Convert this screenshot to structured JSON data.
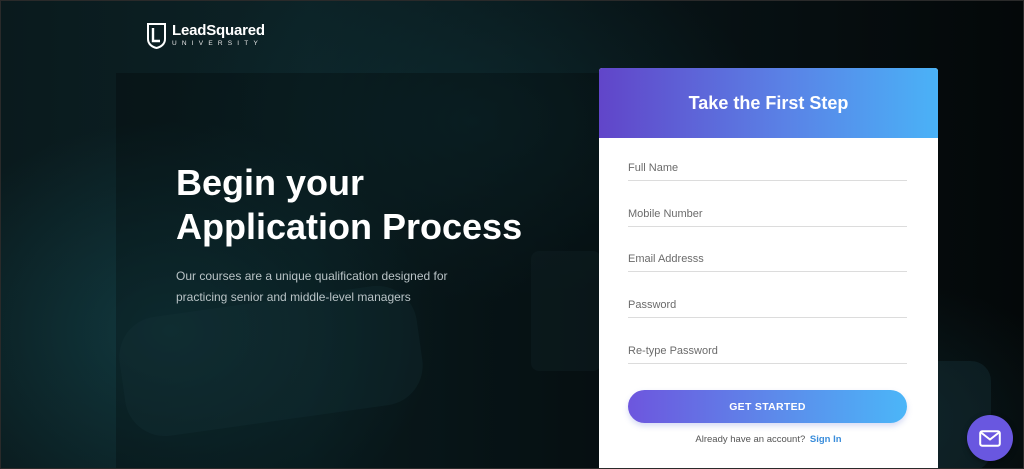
{
  "brand": {
    "name": "LeadSquared",
    "subtitle": "UNIVERSITY",
    "logo_icon": "shield-icon"
  },
  "hero": {
    "title_line1": "Begin your",
    "title_line2": "Application Process",
    "description": "Our courses are a unique qualification designed for practicing senior and middle-level managers"
  },
  "form": {
    "title": "Take the First Step",
    "fields": [
      {
        "placeholder": "Full Name",
        "type": "text"
      },
      {
        "placeholder": "Mobile Number",
        "type": "tel"
      },
      {
        "placeholder": "Email Addresss",
        "type": "email"
      },
      {
        "placeholder": "Password",
        "type": "password"
      },
      {
        "placeholder": "Re-type Password",
        "type": "password"
      }
    ],
    "submit_label": "GET STARTED",
    "signin_prompt": "Already have an account?",
    "signin_link": "Sign In"
  },
  "chat": {
    "icon": "mail-icon"
  },
  "colors": {
    "accent_start": "#6145c9",
    "accent_end": "#4ab2f7",
    "link": "#3a8ddb",
    "chat_bubble": "#6957e0"
  }
}
